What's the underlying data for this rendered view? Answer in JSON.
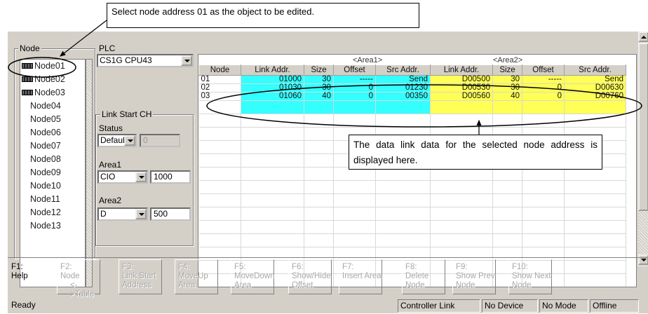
{
  "callouts": {
    "top": "Select node address 01 as the object to be edited.",
    "middle": "The data link data for the selected node address is displayed here."
  },
  "node_panel": {
    "title": "Node",
    "items": [
      {
        "label": "Node01",
        "icon": "plc-unit-icon",
        "selected": true
      },
      {
        "label": "Node02",
        "icon": "plc-unit-icon"
      },
      {
        "label": "Node03",
        "icon": "plc-unit-icon"
      },
      {
        "label": "Node04"
      },
      {
        "label": "Node05"
      },
      {
        "label": "Node06"
      },
      {
        "label": "Node07"
      },
      {
        "label": "Node08"
      },
      {
        "label": "Node09"
      },
      {
        "label": "Node10"
      },
      {
        "label": "Node11"
      },
      {
        "label": "Node12"
      },
      {
        "label": "Node13"
      }
    ]
  },
  "plc_panel": {
    "title": "PLC",
    "plc_model": "CS1G CPU43",
    "link_start_title": "Link Start CH",
    "status_label": "Status",
    "status_value": "Default",
    "status_text": "0",
    "area1_label": "Area1",
    "area1_type": "CIO",
    "area1_value": "1000",
    "area2_label": "Area2",
    "area2_type": "D",
    "area2_value": "500"
  },
  "table": {
    "area1_header": "<Area1>",
    "area2_header": "<Area2>",
    "columns": [
      "Node",
      "Link Addr.",
      "Size",
      "Offset",
      "Src Addr.",
      "Link Addr.",
      "Size",
      "Offset",
      "Src Addr."
    ],
    "rows": [
      [
        "01",
        "01000",
        "30",
        "-----",
        "Send",
        "D00500",
        "30",
        "-----",
        "Send"
      ],
      [
        "02",
        "01030",
        "30",
        "0",
        "01230",
        "D00530",
        "30",
        "0",
        "D00630"
      ],
      [
        "03",
        "01060",
        "40",
        "0",
        "00350",
        "D00560",
        "40",
        "0",
        "D00760"
      ]
    ]
  },
  "function_keys": [
    {
      "key": "F1:",
      "label": "Help",
      "enabled": true
    },
    {
      "key": "F2:",
      "label": "Node",
      "label2": "<->Table",
      "enabled": false
    },
    {
      "key": "F3:",
      "label": "Link Start",
      "label2": "Address",
      "enabled": false
    },
    {
      "key": "F4:",
      "label": "MoveUp",
      "label2": "Area",
      "enabled": false
    },
    {
      "key": "F5:",
      "label": "MoveDown",
      "label2": "Area",
      "enabled": false
    },
    {
      "key": "F6:",
      "label": "Show/Hide",
      "label2": "Offset",
      "enabled": false
    },
    {
      "key": "F7:",
      "label": "Insert Area",
      "enabled": false
    },
    {
      "key": "F8:",
      "label": "Delete",
      "label2": "Node",
      "enabled": false
    },
    {
      "key": "F9:",
      "label": "Show Prev",
      "label2": "Node",
      "enabled": false
    },
    {
      "key": "F10:",
      "label": "Show Next",
      "label2": "Node",
      "enabled": false
    }
  ],
  "status_bar": {
    "ready": "Ready",
    "connection": "Controller Link",
    "device": "No Device",
    "mode": "No Mode",
    "online": "Offline"
  },
  "colors": {
    "area1_fill": "#33ffff",
    "area2_fill": "#ffff55",
    "window_bg": "#d4d0c8"
  }
}
